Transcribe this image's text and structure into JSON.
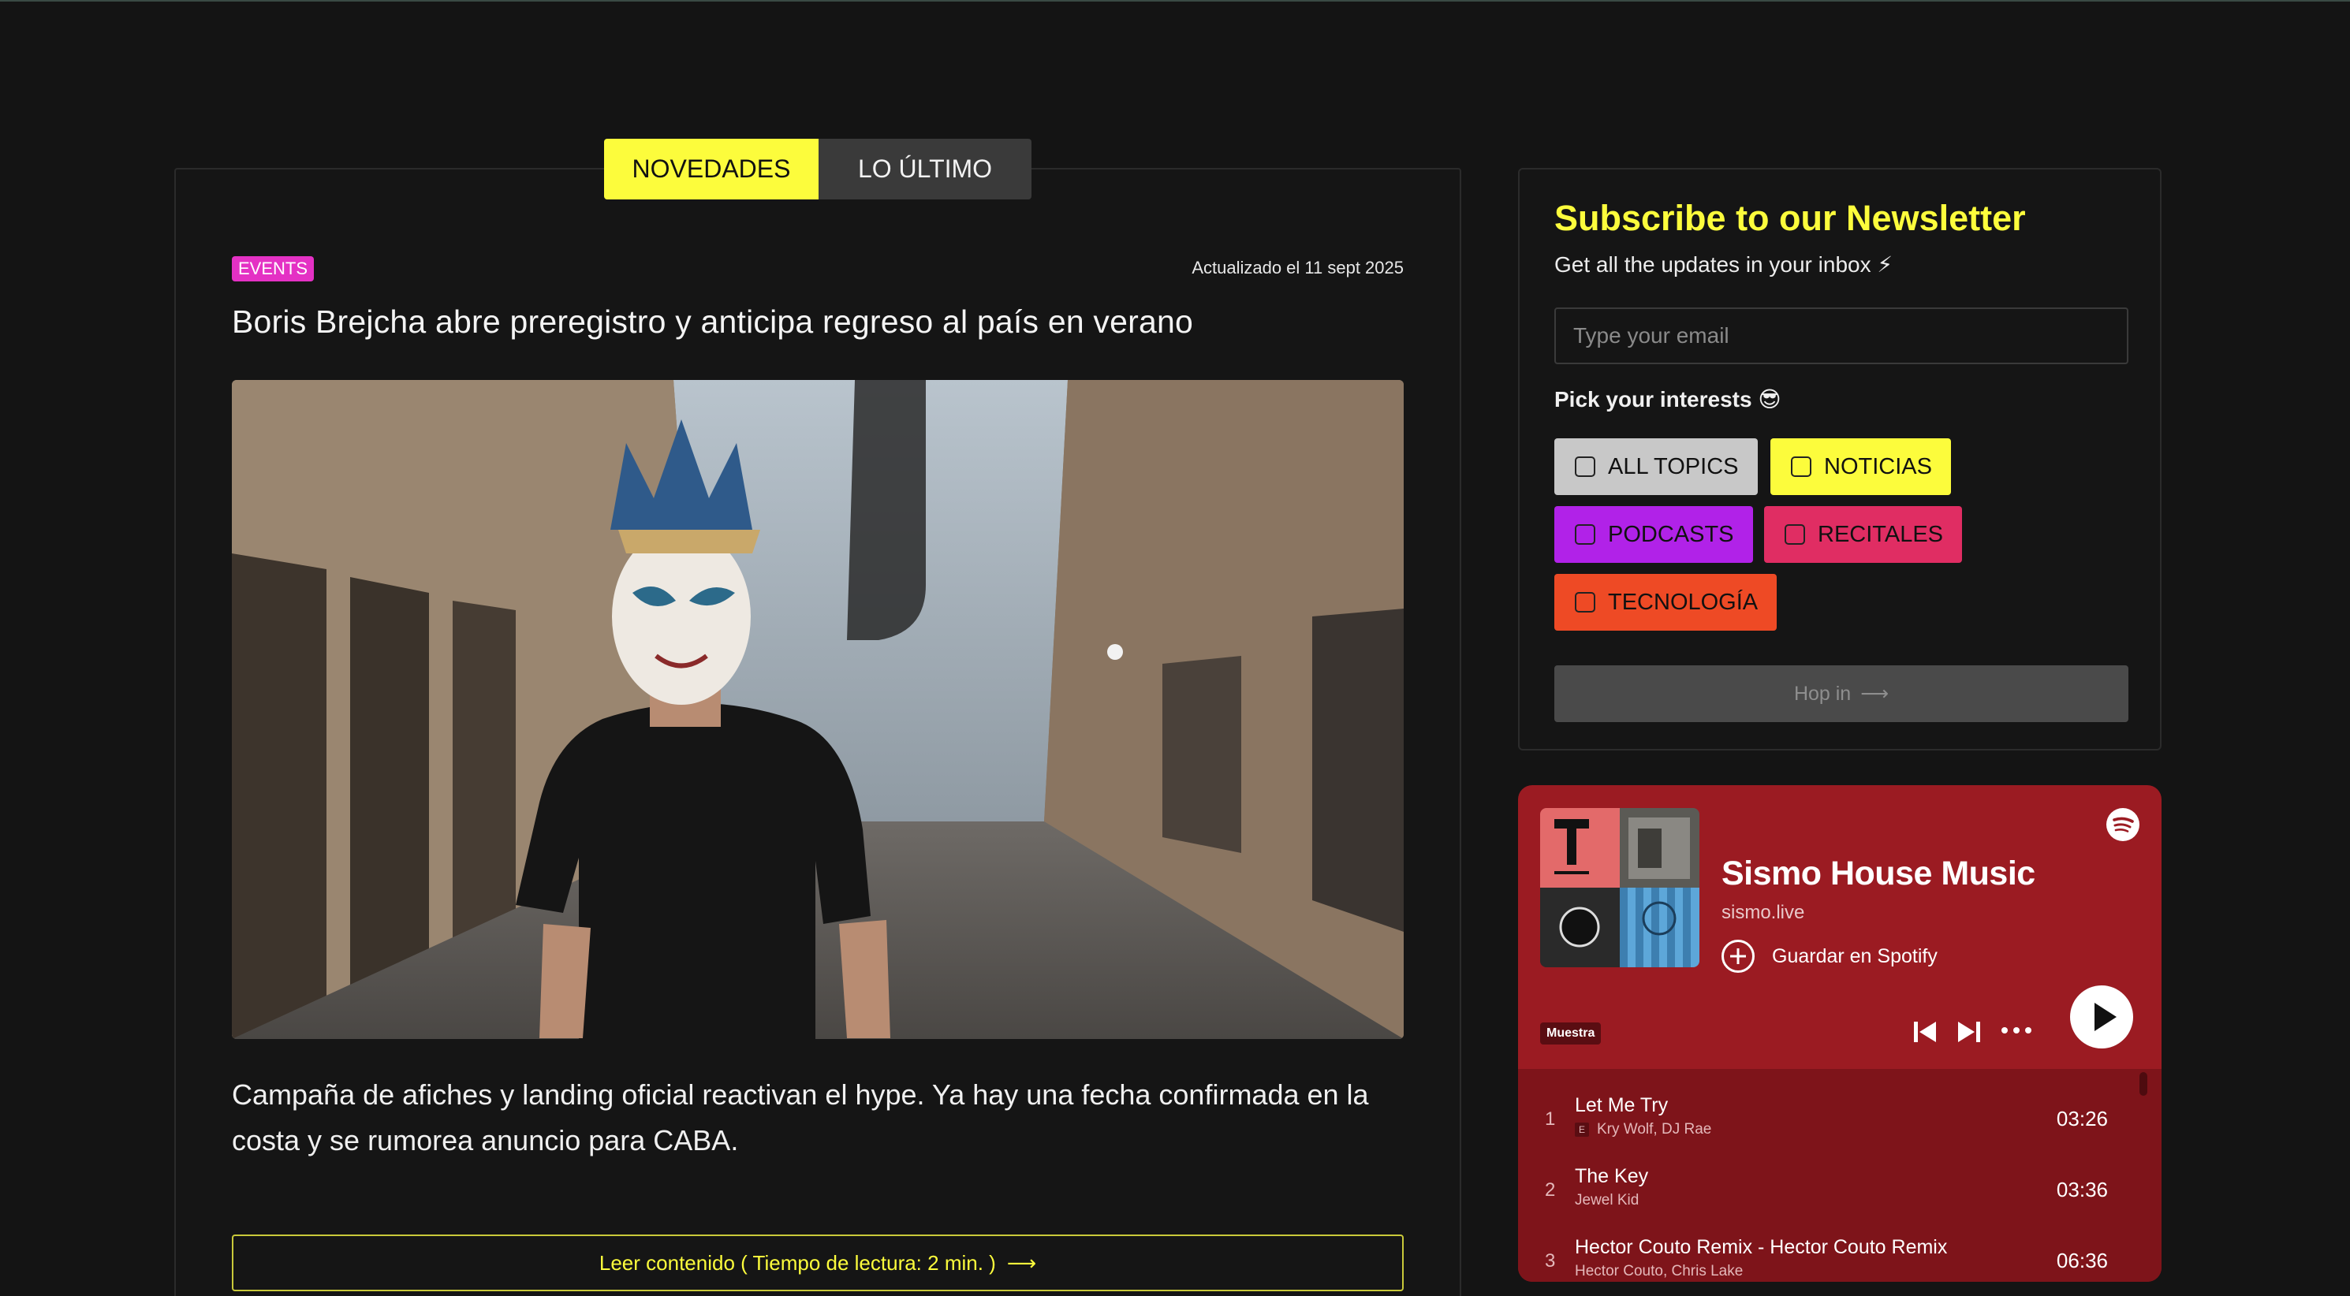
{
  "tabs": {
    "active": "NOVEDADES",
    "inactive": "LO ÚLTIMO"
  },
  "article": {
    "badge": "EVENTS",
    "updated": "Actualizado el 11 sept 2025",
    "headline": "Boris Brejcha abre preregistro y anticipa regreso al país en verano",
    "excerpt": "Campaña de afiches y landing oficial reactivan el hype. Ya hay una fecha confirmada en la costa y se rumorea anuncio para CABA.",
    "read_button": "Leer contenido ( Tiempo de lectura: 2 min. )",
    "read_arrow": "⟶"
  },
  "newsletter": {
    "title": "Subscribe to our Newsletter",
    "subtitle": "Get all the updates in your inbox ⚡",
    "email_placeholder": "Type your email",
    "pick_label": "Pick your interests 😎",
    "chips": [
      {
        "label": "ALL TOPICS",
        "color": "#c8c8c8"
      },
      {
        "label": "NOTICIAS",
        "color": "#fcfc3c"
      },
      {
        "label": "PODCASTS",
        "color": "#b122e8"
      },
      {
        "label": "RECITALES",
        "color": "#e02d63"
      },
      {
        "label": "TECNOLOGÍA",
        "color": "#ee4a25"
      }
    ],
    "submit": "Hop in",
    "submit_arrow": "⟶"
  },
  "spotify": {
    "playlist_title": "Sismo House Music",
    "site": "sismo.live",
    "save_label": "Guardar en Spotify",
    "preview_badge": "Muestra",
    "tracks": [
      {
        "num": "1",
        "title": "Let Me Try",
        "explicit": "E",
        "artists": "Kry Wolf, DJ Rae",
        "duration": "03:26"
      },
      {
        "num": "2",
        "title": "The Key",
        "artists": "Jewel Kid",
        "duration": "03:36"
      },
      {
        "num": "3",
        "title": "Hector Couto Remix - Hector Couto Remix",
        "artists": "Hector Couto, Chris Lake",
        "duration": "06:36"
      }
    ]
  }
}
